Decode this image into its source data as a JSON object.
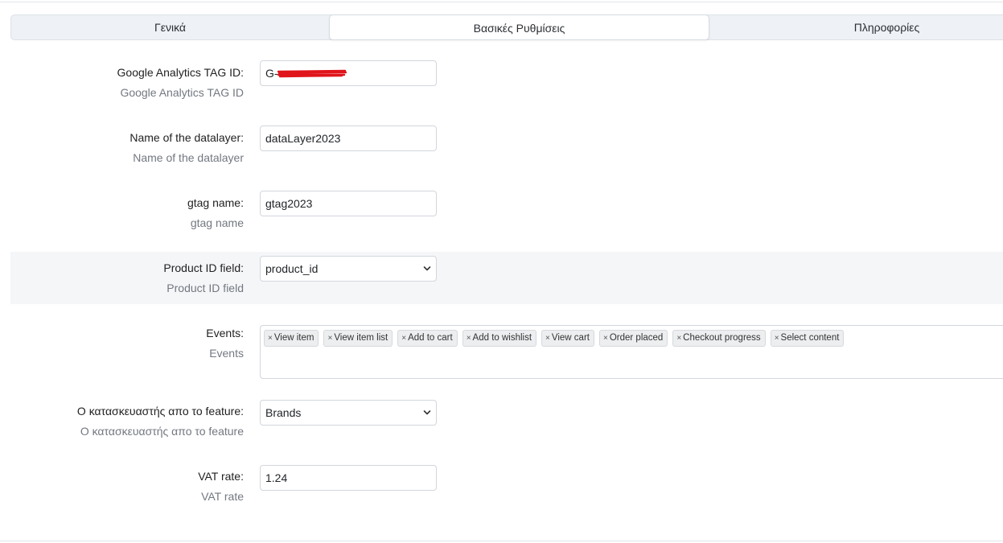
{
  "tabs": {
    "general": "Γενικά",
    "basic_settings": "Βασικές Ρυθμίσεις",
    "info": "Πληροφορίες"
  },
  "form": {
    "ga_tag_id": {
      "label": "Google Analytics TAG ID:",
      "help": "Google Analytics TAG ID",
      "value": "G-"
    },
    "datalayer_name": {
      "label": "Name of the datalayer:",
      "help": "Name of the datalayer",
      "value": "dataLayer2023"
    },
    "gtag_name": {
      "label": "gtag name:",
      "help": "gtag name",
      "value": "gtag2023"
    },
    "product_id_field": {
      "label": "Product ID field:",
      "help": "Product ID field",
      "selected": "product_id"
    },
    "events": {
      "label": "Events:",
      "help": "Events",
      "tags": [
        "View item",
        "View item list",
        "Add to cart",
        "Add to wishlist",
        "View cart",
        "Order placed",
        "Checkout progress",
        "Select content"
      ]
    },
    "manufacturer_feature": {
      "label": "Ο κατασκευαστής απο το feature:",
      "help": "Ο κατασκευαστής απο το feature",
      "selected": "Brands"
    },
    "vat_rate": {
      "label": "VAT rate:",
      "help": "VAT rate",
      "value": "1.24"
    }
  },
  "icons": {
    "select_chevron": "chevron-down-icon",
    "tag_remove": "×"
  },
  "colors": {
    "redaction": "#e0141b",
    "tab_bar_bg": "#eef1f5",
    "alt_row_bg": "#f5f6f8"
  }
}
